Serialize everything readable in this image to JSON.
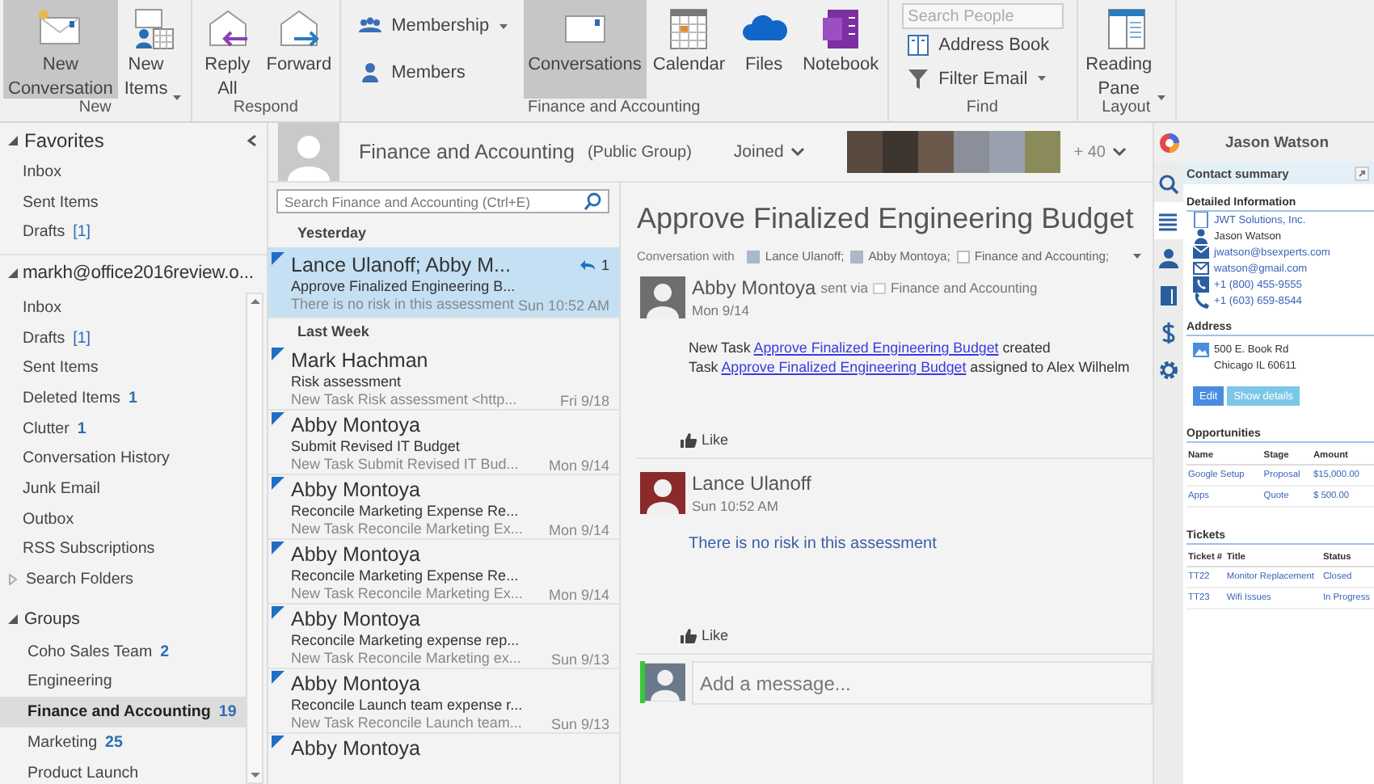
{
  "ribbon": {
    "groups": [
      {
        "label": "New",
        "buttons": [
          {
            "kind": "large",
            "label": "New Conversation",
            "selected": true,
            "dropdown": false
          },
          {
            "kind": "large",
            "label": "New Items",
            "selected": false,
            "dropdown": true
          }
        ]
      },
      {
        "label": "Respond",
        "buttons": [
          {
            "kind": "large",
            "label": "Reply All",
            "selected": false,
            "dropdown": false
          },
          {
            "kind": "large",
            "label": "Forward",
            "selected": false,
            "dropdown": false
          }
        ]
      },
      {
        "label": "Finance and Accounting",
        "buttons": [
          {
            "kind": "small",
            "label": "Membership",
            "selected": false,
            "dropdown": true
          },
          {
            "kind": "small",
            "label": "Members",
            "selected": false,
            "dropdown": false
          },
          {
            "kind": "large",
            "label": "Conversations",
            "selected": true,
            "dropdown": false
          },
          {
            "kind": "large",
            "label": "Calendar",
            "selected": false,
            "dropdown": false
          },
          {
            "kind": "large",
            "label": "Files",
            "selected": false,
            "dropdown": false
          },
          {
            "kind": "large",
            "label": "Notebook",
            "selected": false,
            "dropdown": false
          }
        ]
      },
      {
        "label": "Find",
        "buttons": [
          {
            "kind": "search",
            "placeholder": "Search People"
          },
          {
            "kind": "small",
            "label": "Address Book",
            "selected": false,
            "dropdown": false
          },
          {
            "kind": "small",
            "label": "Filter Email",
            "selected": false,
            "dropdown": true
          }
        ]
      },
      {
        "label": "Layout",
        "buttons": [
          {
            "kind": "large",
            "label": "Reading Pane",
            "selected": false,
            "dropdown": true
          }
        ]
      }
    ]
  },
  "nav": {
    "sections": [
      {
        "kind": "main",
        "label": "Favorites",
        "expanded": true,
        "items": [
          {
            "label": "Inbox",
            "selected": false
          },
          {
            "label": "Sent Items",
            "selected": false
          },
          {
            "label": "Drafts",
            "count": "[1]",
            "count_bold": false,
            "selected": false
          }
        ]
      },
      {
        "kind": "main",
        "label": "markh@office2016review.o...",
        "expanded": true,
        "items": [
          {
            "label": "Inbox",
            "selected": false
          },
          {
            "label": "Drafts",
            "count": "[1]",
            "count_bold": false,
            "selected": false
          },
          {
            "label": "Sent Items",
            "selected": false
          },
          {
            "label": "Deleted Items",
            "count": "1",
            "count_bold": true,
            "selected": false
          },
          {
            "label": "Clutter",
            "count": "1",
            "count_bold": true,
            "selected": false
          },
          {
            "label": "Conversation History",
            "selected": false
          },
          {
            "label": "Junk Email",
            "selected": false
          },
          {
            "label": "Outbox",
            "selected": false
          },
          {
            "label": "RSS Subscriptions",
            "selected": false
          },
          {
            "label": "Search Folders",
            "expanded": false,
            "selected": false
          }
        ]
      },
      {
        "kind": "sub",
        "label": "Groups",
        "expanded": true,
        "items": [
          {
            "label": "Coho Sales Team",
            "count": "2",
            "count_bold": true,
            "selected": false
          },
          {
            "label": "Engineering",
            "selected": false
          },
          {
            "label": "Finance and Accounting",
            "count": "19",
            "count_bold": true,
            "selected": true
          },
          {
            "label": "Marketing",
            "count": "25",
            "count_bold": true,
            "selected": false
          },
          {
            "label": "Product Launch",
            "selected": false
          }
        ]
      }
    ]
  },
  "group_header": {
    "name": "Finance and Accounting",
    "visibility": "(Public Group)",
    "membership": "Joined",
    "member_count": "+ 40"
  },
  "list": {
    "search": {
      "placeholder": "Search Finance and Accounting (Ctrl+E)"
    },
    "sections": [
      {
        "label": "Yesterday",
        "messages": [
          {
            "sender": "Lance Ulanoff; Abby M...",
            "subject": "Approve Finalized Engineering B...",
            "preview": "There is no risk in this assessment",
            "date": "Sun 10:52 AM",
            "replies": "1",
            "unread": true,
            "selected": true
          }
        ]
      },
      {
        "label": "Last Week",
        "messages": [
          {
            "sender": "Mark Hachman",
            "subject": "Risk assessment",
            "preview": "New Task Risk assessment <http...",
            "date": "Fri 9/18",
            "unread": true,
            "selected": false
          },
          {
            "sender": "Abby Montoya",
            "subject": "Submit Revised IT Budget",
            "preview": "New Task Submit Revised IT Bud...",
            "date": "Mon 9/14",
            "unread": true,
            "selected": false
          },
          {
            "sender": "Abby Montoya",
            "subject": "Reconcile Marketing Expense Re...",
            "preview": "New Task Reconcile Marketing Ex...",
            "date": "Mon 9/14",
            "unread": true,
            "selected": false
          },
          {
            "sender": "Abby Montoya",
            "subject": "Reconcile Marketing Expense Re...",
            "preview": "New Task Reconcile Marketing Ex...",
            "date": "Mon 9/14",
            "unread": true,
            "selected": false
          },
          {
            "sender": "Abby Montoya",
            "subject": "Reconcile Marketing expense rep...",
            "preview": "New Task Reconcile Marketing ex...",
            "date": "Sun 9/13",
            "unread": true,
            "selected": false
          },
          {
            "sender": "Abby Montoya",
            "subject": "Reconcile Launch team expense r...",
            "preview": "New Task Reconcile Launch team...",
            "date": "Sun 9/13",
            "unread": true,
            "selected": false
          },
          {
            "sender": "Abby Montoya",
            "unread": true,
            "selected": false
          }
        ]
      }
    ]
  },
  "reading": {
    "title": "Approve Finalized Engineering Budget",
    "participants_label": "Conversation with",
    "participants": [
      {
        "kind": "person",
        "name": "Lance Ulanoff;"
      },
      {
        "kind": "person",
        "name": "Abby Montoya;"
      },
      {
        "kind": "group",
        "name": "Finance and Accounting;"
      }
    ],
    "posts": [
      {
        "author": "Abby Montoya",
        "via_label": "sent via",
        "via": "Finance and Accounting",
        "date": "Mon 9/14",
        "like": "Like",
        "body": [
          [
            {
              "kind": "text",
              "text": "New Task "
            },
            {
              "kind": "link",
              "text": "Approve Finalized Engineering Budget"
            },
            {
              "kind": "text",
              "text": " created"
            }
          ],
          [
            {
              "kind": "text",
              "text": "Task "
            },
            {
              "kind": "link",
              "text": "Approve Finalized Engineering Budget"
            },
            {
              "kind": "text",
              "text": " assigned to Alex Wilhelm"
            }
          ]
        ]
      },
      {
        "author": "Lance Ulanoff",
        "date": "Sun 10:52 AM",
        "like": "Like",
        "body": [
          [
            {
              "kind": "reply",
              "text": "There is no risk in this assessment"
            }
          ]
        ]
      }
    ],
    "composer": {
      "placeholder": "Add a message..."
    }
  },
  "crm": {
    "title": "Jason Watson",
    "tabs": [
      {
        "selected": false
      },
      {
        "selected": true
      },
      {
        "selected": false
      },
      {
        "selected": false
      },
      {
        "selected": false
      },
      {
        "selected": false
      }
    ],
    "summary_title": "Contact summary",
    "details": {
      "title": "Detailed Information",
      "rows": [
        {
          "kind": "link",
          "text": "JWT Solutions, Inc."
        },
        {
          "kind": "plain",
          "text": "Jason  Watson"
        },
        {
          "kind": "link",
          "text": "jwatson@bsexperts.com"
        },
        {
          "kind": "link",
          "text": "watson@gmail.com"
        },
        {
          "kind": "link",
          "text": "+1 (800) 455-9555"
        },
        {
          "kind": "link",
          "text": "+1 (603) 659-8544"
        }
      ]
    },
    "address": {
      "title": "Address",
      "lines": [
        "500 E. Book Rd",
        "Chicago  IL  60611"
      ]
    },
    "buttons": [
      {
        "kind": "primary",
        "label": "Edit"
      },
      {
        "kind": "secondary",
        "label": "Show details"
      }
    ],
    "tables": [
      {
        "title": "Opportunities",
        "columns": [
          "Name",
          "Stage",
          "Amount"
        ],
        "rows": [
          [
            "Google Setup",
            "Proposal",
            "$15,000.00"
          ],
          [
            "Apps",
            "Quote",
            "$ 500.00"
          ]
        ]
      },
      {
        "title": "Tickets",
        "columns": [
          "Ticket #",
          "Title",
          "Status"
        ],
        "rows": [
          [
            "TT22",
            "Monitor Replacement",
            "Closed"
          ],
          [
            "TT23",
            "Wifi Issues",
            "In Progress"
          ]
        ]
      }
    ]
  }
}
